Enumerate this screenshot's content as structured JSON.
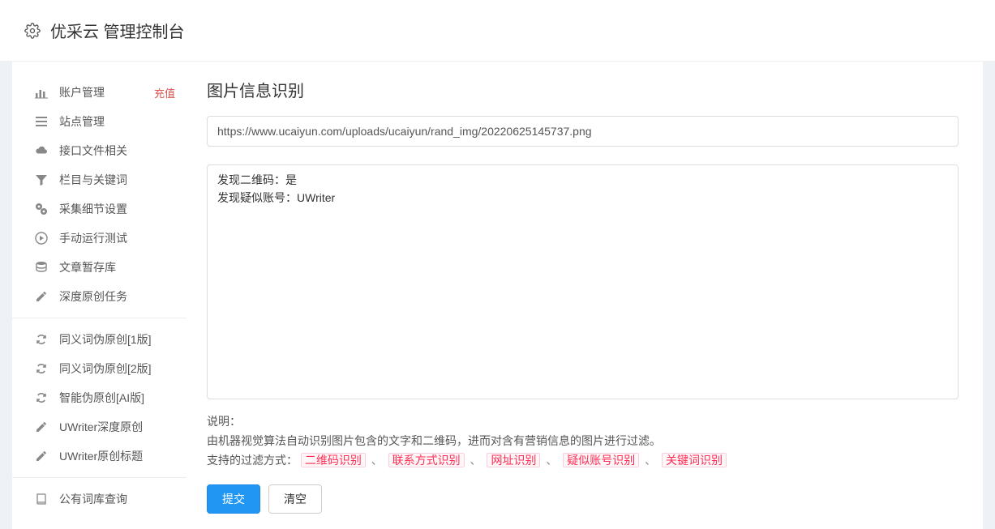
{
  "header": {
    "title": "优采云 管理控制台"
  },
  "sidebar": {
    "groups": [
      [
        {
          "label": "账户管理",
          "badge": "充值"
        },
        {
          "label": "站点管理"
        },
        {
          "label": "接口文件相关"
        },
        {
          "label": "栏目与关键词"
        },
        {
          "label": "采集细节设置"
        },
        {
          "label": "手动运行测试"
        },
        {
          "label": "文章暂存库"
        },
        {
          "label": "深度原创任务"
        }
      ],
      [
        {
          "label": "同义词伪原创[1版]"
        },
        {
          "label": "同义词伪原创[2版]"
        },
        {
          "label": "智能伪原创[AI版]"
        },
        {
          "label": "UWriter深度原创"
        },
        {
          "label": "UWriter原创标题"
        }
      ],
      [
        {
          "label": "公有词库查询"
        }
      ]
    ]
  },
  "main": {
    "title": "图片信息识别",
    "url_value": "https://www.ucaiyun.com/uploads/ucaiyun/rand_img/20220625145737.png",
    "result_text": "发现二维码：是\n发现疑似账号：UWriter",
    "desc_label": "说明：",
    "desc_line1": "由机器视觉算法自动识别图片包含的文字和二维码，进而对含有营销信息的图片进行过滤。",
    "desc_line2_prefix": "支持的过滤方式：",
    "tags": [
      "二维码识别",
      "联系方式识别",
      "网址识别",
      "疑似账号识别",
      "关键词识别"
    ],
    "submit_label": "提交",
    "clear_label": "清空"
  }
}
